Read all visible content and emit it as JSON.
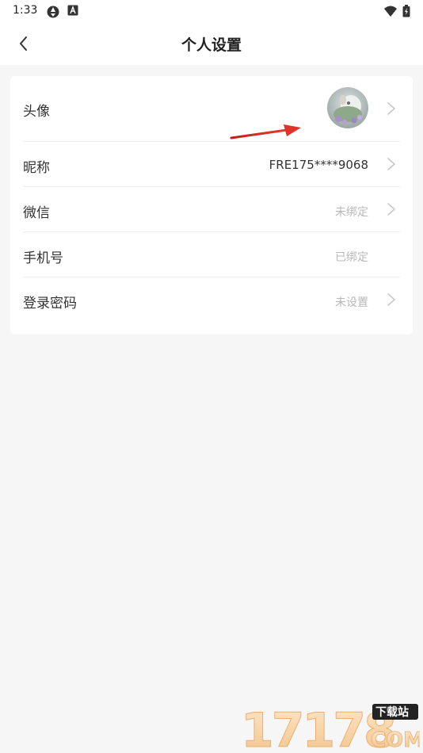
{
  "status": {
    "time": "1:33"
  },
  "header": {
    "title": "个人设置"
  },
  "rows": [
    {
      "label": "头像",
      "value": ""
    },
    {
      "label": "昵称",
      "value": "FRE175****9068"
    },
    {
      "label": "微信",
      "value": "未绑定"
    },
    {
      "label": "手机号",
      "value": "已绑定"
    },
    {
      "label": "登录密码",
      "value": "未设置"
    }
  ],
  "watermark": {
    "digits": "17178",
    "top": "下载站",
    "bottom": "COM"
  },
  "colors": {
    "background": "#f6f6f6",
    "card": "#ffffff",
    "muted_text": "#b8b8b8",
    "annotation_arrow": "#e0322b"
  }
}
